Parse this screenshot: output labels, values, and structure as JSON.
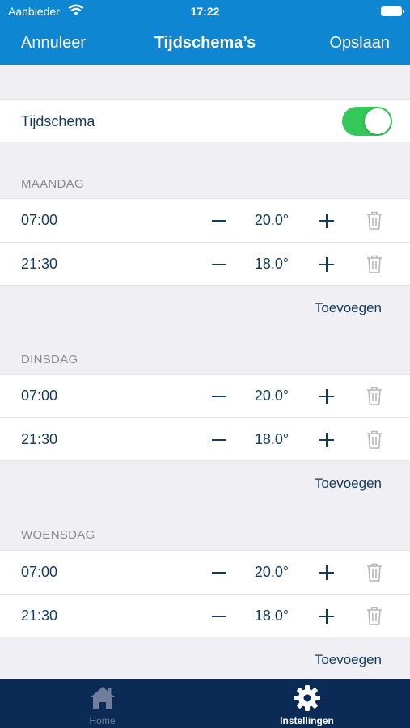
{
  "status_bar": {
    "carrier": "Aanbieder",
    "time": "17:22"
  },
  "nav": {
    "cancel_label": "Annuleer",
    "title": "Tijdschema’s",
    "save_label": "Opslaan"
  },
  "schedule_toggle": {
    "label": "Tijdschema",
    "on": true
  },
  "days": [
    {
      "name": "MAANDAG",
      "entries": [
        {
          "time": "07:00",
          "temp": "20.0°"
        },
        {
          "time": "21:30",
          "temp": "18.0°"
        }
      ],
      "add_label": "Toevoegen"
    },
    {
      "name": "DINSDAG",
      "entries": [
        {
          "time": "07:00",
          "temp": "20.0°"
        },
        {
          "time": "21:30",
          "temp": "18.0°"
        }
      ],
      "add_label": "Toevoegen"
    },
    {
      "name": "WOENSDAG",
      "entries": [
        {
          "time": "07:00",
          "temp": "20.0°"
        },
        {
          "time": "21:30",
          "temp": "18.0°"
        }
      ],
      "add_label": "Toevoegen"
    }
  ],
  "tabbar": {
    "items": [
      {
        "label": "Home",
        "icon": "home-icon",
        "active": false
      },
      {
        "label": "Instellingen",
        "icon": "gear-icon",
        "active": true
      }
    ]
  },
  "colors": {
    "header": "#0f86d1",
    "text_primary": "#123a5c",
    "toggle_on": "#34c759",
    "tabbar": "#0b2a55",
    "background": "#efeff4"
  }
}
